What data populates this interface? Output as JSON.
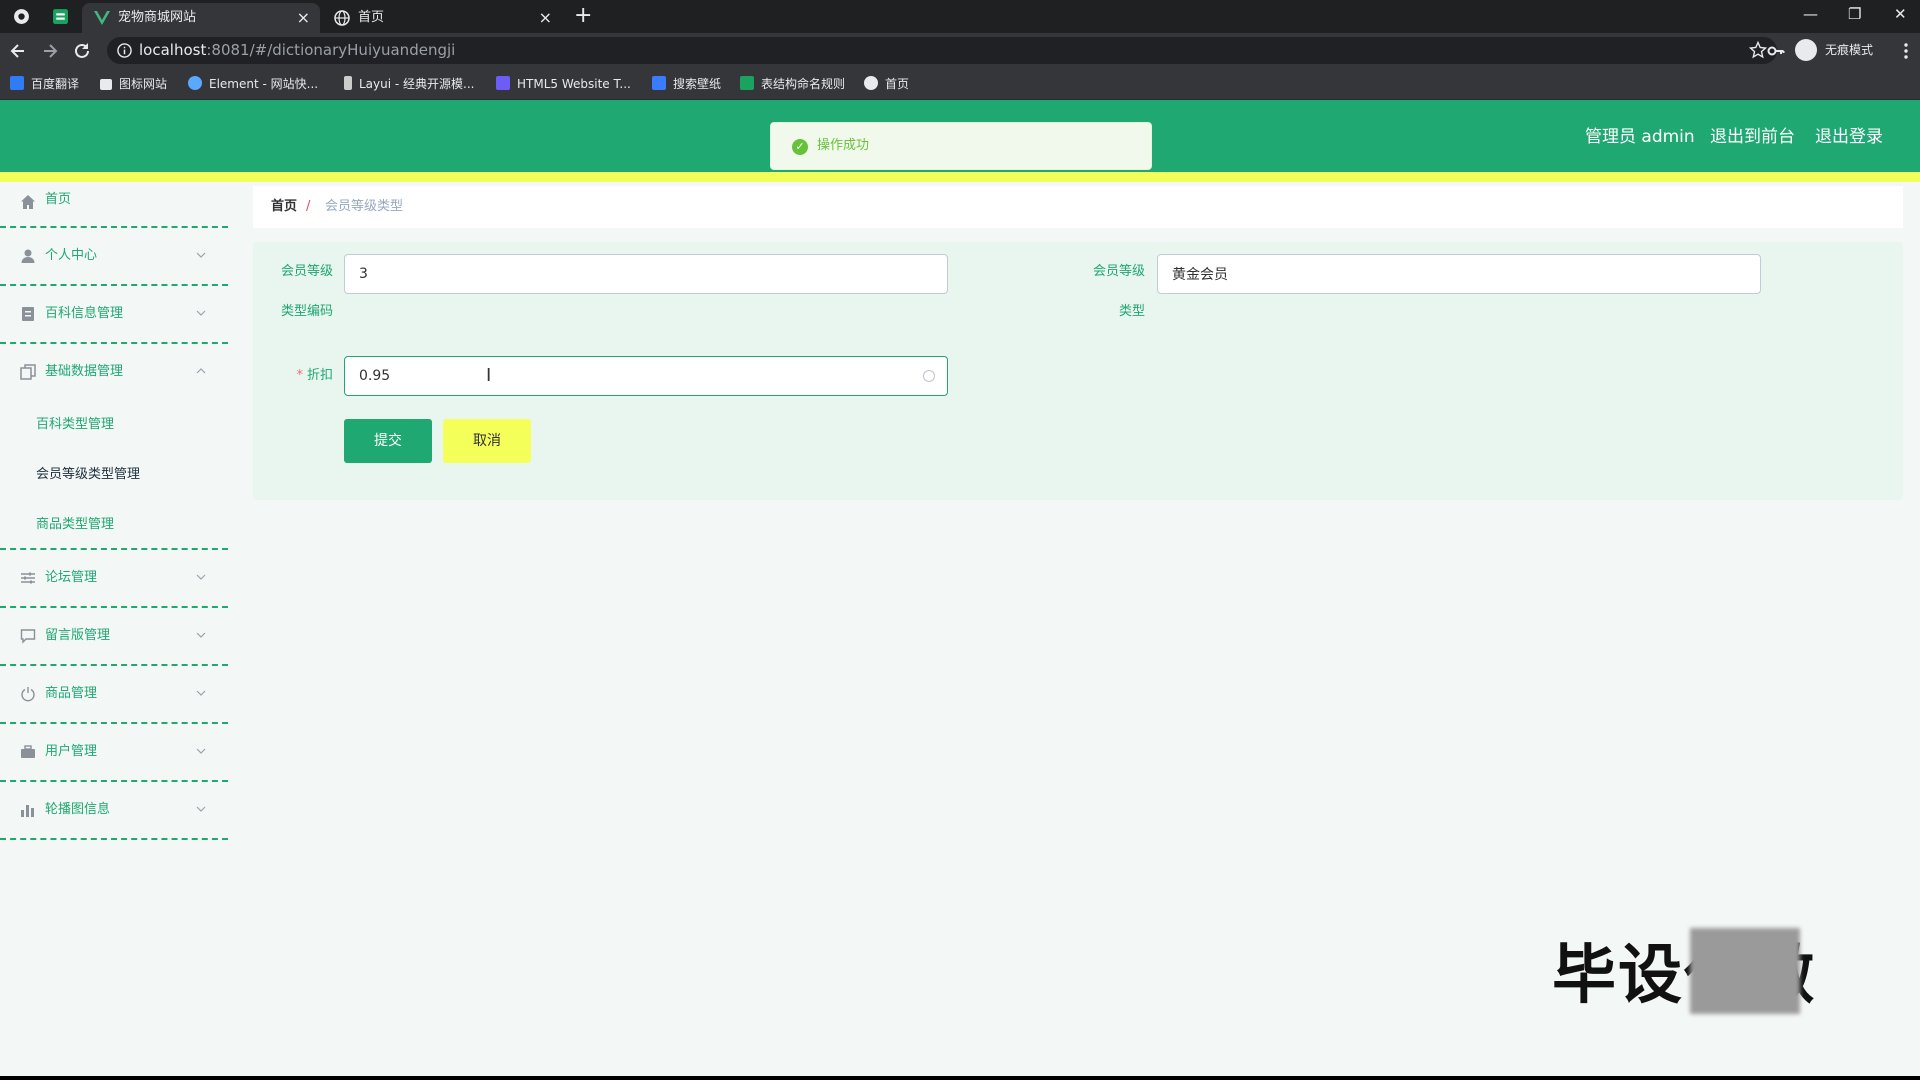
{
  "browser": {
    "tabs": [
      {
        "title": "宠物商城网站",
        "close": "×"
      },
      {
        "title": "首页",
        "close": "×"
      }
    ],
    "new_tab": "+",
    "window_controls": [
      "—",
      "❐",
      "✕"
    ],
    "url_host": "localhost",
    "url_rest": ":8081/#/dictionaryHuiyuandengji",
    "incognito_label": "无痕模式",
    "bookmarks": [
      {
        "label": "百度翻译",
        "color": "#2f7cf6"
      },
      {
        "label": "图标网站",
        "color": "#ffffff"
      },
      {
        "label": "Element - 网站快...",
        "color": "#5aa9ff"
      },
      {
        "label": "Layui - 经典开源模...",
        "color": "#cccccc"
      },
      {
        "label": "HTML5 Website T...",
        "color": "#6d5cf6"
      },
      {
        "label": "搜索壁纸",
        "color": "#3b7bff"
      },
      {
        "label": "表结构命名规则",
        "color": "#1aa260"
      },
      {
        "label": "首页",
        "color": "#ffffff"
      }
    ]
  },
  "header": {
    "admin_label": "管理员 admin",
    "to_front": "退出到前台",
    "logout": "退出登录",
    "accent": "#1fa872",
    "strip": "#f0ff5a"
  },
  "toast": {
    "message": "操作成功",
    "icon": "check-circle-icon"
  },
  "sidebar": {
    "items": [
      {
        "label": "首页",
        "icon": "home-icon",
        "expandable": false
      },
      {
        "label": "个人中心",
        "icon": "user-icon",
        "expandable": true
      },
      {
        "label": "百科信息管理",
        "icon": "document-icon",
        "expandable": true
      },
      {
        "label": "基础数据管理",
        "icon": "copy-icon",
        "expandable": true,
        "expanded": true
      },
      {
        "label": "论坛管理",
        "icon": "sliders-icon",
        "expandable": true
      },
      {
        "label": "留言版管理",
        "icon": "chat-icon",
        "expandable": true
      },
      {
        "label": "商品管理",
        "icon": "power-icon",
        "expandable": true
      },
      {
        "label": "用户管理",
        "icon": "briefcase-icon",
        "expandable": true
      },
      {
        "label": "轮播图信息",
        "icon": "bar-chart-icon",
        "expandable": true
      }
    ],
    "sub_items": [
      {
        "label": "百科类型管理"
      },
      {
        "label": "会员等级类型管理"
      },
      {
        "label": "商品类型管理"
      }
    ]
  },
  "breadcrumb": {
    "home": "首页",
    "separator": "/",
    "current": "会员等级类型"
  },
  "form": {
    "code_label_1": "会员等级",
    "code_label_2": "类型编码",
    "code_value": "3",
    "type_label_1": "会员等级",
    "type_label_2": "类型",
    "type_value": "黄金会员",
    "discount_required": "*",
    "discount_label": "折扣",
    "discount_value": "0.95",
    "submit": "提交",
    "cancel": "取消"
  },
  "watermark": {
    "text": "毕设代做"
  }
}
